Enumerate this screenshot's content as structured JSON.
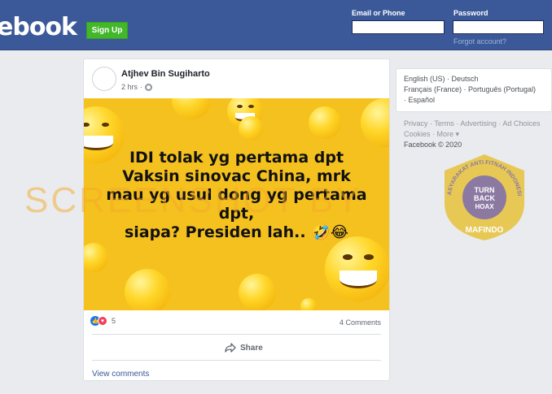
{
  "header": {
    "logo_text": "ebook",
    "signup_label": "Sign Up",
    "email_label": "Email or Phone",
    "password_label": "Password",
    "forgot_label": "Forgot account?"
  },
  "post": {
    "author": "Atjhev Bin Sugiharto",
    "time": "2 hrs",
    "image_text_lines": [
      "IDI tolak yg pertama dpt",
      "Vaksin sinovac China, mrk",
      "mau yg usul dong yg pertama",
      "dpt,",
      "siapa? Presiden lah.. 🤣😂"
    ],
    "watermark": "SCREENSHOT BY",
    "reaction_count": "5",
    "comments_count": "4 Comments",
    "share_label": "Share",
    "view_comments_label": "View comments"
  },
  "sidebar": {
    "languages": [
      "English (US)",
      "Deutsch",
      "Français (France)",
      "Português (Portugal)",
      "Español"
    ],
    "footer_links": [
      "Privacy",
      "Terms",
      "Advertising",
      "Ad Choices",
      "Cookies",
      "More"
    ],
    "copyright": "Facebook © 2020"
  },
  "badge": {
    "arc_text": "MASYARAKAT ANTI FITNAH INDONESIA",
    "line1": "TURN",
    "line2": "BACK",
    "line3": "HOAX",
    "org": "MAFINDO"
  },
  "colors": {
    "brand_blue": "#3b5998",
    "signup_green": "#42b72a",
    "image_yellow": "#f5c11f",
    "badge_gold": "#e6c23a",
    "badge_purple": "#7b6bb0"
  }
}
